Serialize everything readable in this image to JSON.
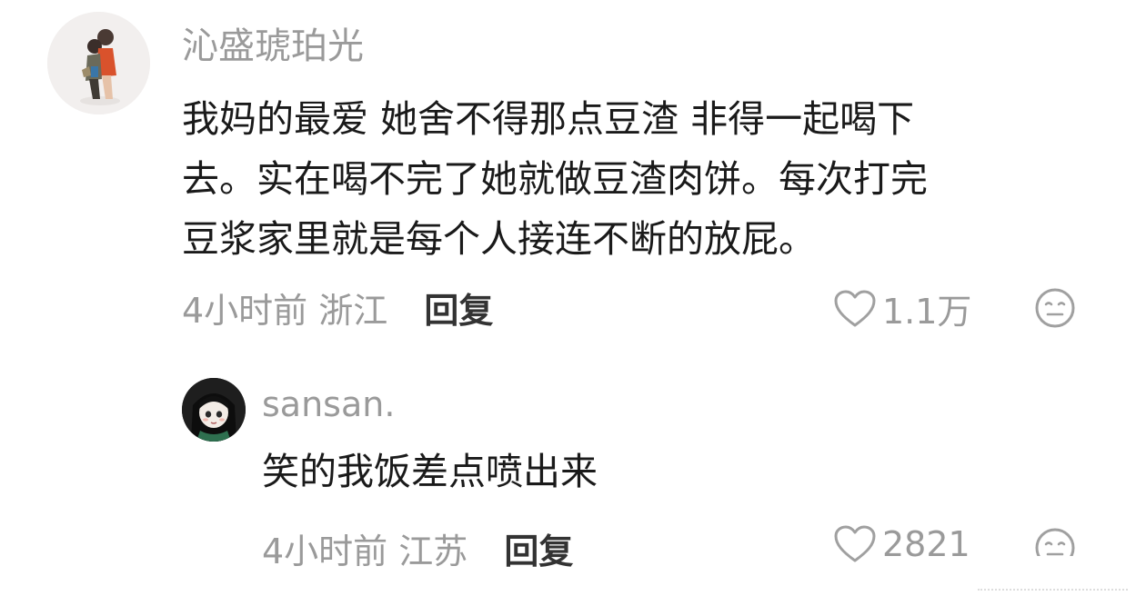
{
  "comment": {
    "username": "沁盛琥珀光",
    "content_lines": [
      "我妈的最爱 她舍不得那点豆渣 非得一起喝下",
      "去。实在喝不完了她就做豆渣肉饼。每次打完",
      "豆浆家里就是每个人接连不断的放屁。"
    ],
    "time": "4小时前",
    "location": "浙江",
    "reply_label": "回复",
    "likes": "1.1万",
    "avatar_icon": "avatar-illustration-icon",
    "like_icon": "heart-outline-icon",
    "dislike_icon": "meh-face-icon"
  },
  "reply": {
    "username": "sansan.",
    "content": "笑的我饭差点喷出来",
    "time": "4小时前",
    "location": "江苏",
    "reply_label": "回复",
    "likes": "2821",
    "avatar_icon": "avatar-girl-icon",
    "like_icon": "heart-outline-icon",
    "dislike_icon": "meh-face-icon"
  },
  "colors": {
    "text_primary": "#1a1a1a",
    "text_secondary": "#9a9a9a",
    "reply_button": "#333333",
    "background": "#ffffff"
  }
}
